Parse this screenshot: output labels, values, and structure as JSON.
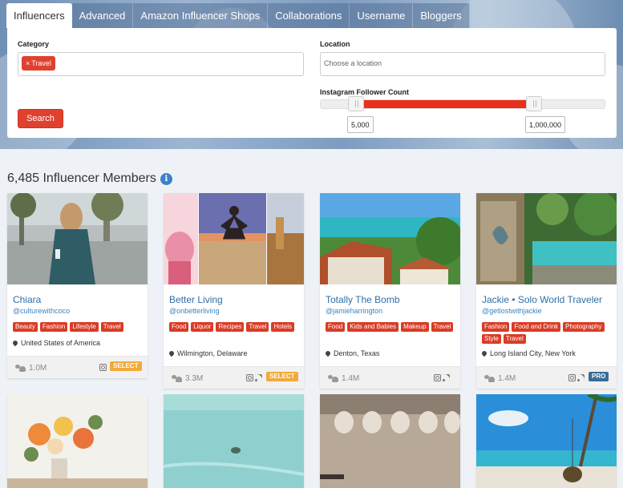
{
  "tabs": [
    "Influencers",
    "Advanced",
    "Amazon Influencer Shops",
    "Collaborations",
    "Username",
    "Bloggers"
  ],
  "filters": {
    "category_label": "Category",
    "category_chip": "Travel",
    "location_label": "Location",
    "location_placeholder": "Choose a location",
    "follower_label": "Instagram Follower Count",
    "follower_min": "5,000",
    "follower_max": "1,000,000",
    "search_label": "Search"
  },
  "members_count": "6,485 Influencer Members",
  "cards": [
    {
      "name": "Chiara",
      "handle": "@culturewithcoco",
      "tags": [
        "Beauty",
        "Fashion",
        "Lifestyle",
        "Travel"
      ],
      "location": "United States of America",
      "followers": "1.0M",
      "badge": "SELECT"
    },
    {
      "name": "Better Living",
      "handle": "@onbetterliving",
      "tags": [
        "Food",
        "Liquor",
        "Recipes",
        "Travel",
        "Hotels"
      ],
      "location": "Wilmington, Delaware",
      "followers": "3.3M",
      "badge": "SELECT"
    },
    {
      "name": "Totally The Bomb",
      "handle": "@jamieharrington",
      "tags": [
        "Food",
        "Kids and Babies",
        "Makeup",
        "Travel"
      ],
      "location": "Denton, Texas",
      "followers": "1.4M",
      "badge": ""
    },
    {
      "name": "Jackie • Solo World Traveler",
      "handle": "@getlostwithjackie",
      "tags": [
        "Fashion",
        "Food and Drink",
        "Photography",
        "Style",
        "Travel"
      ],
      "location": "Long Island City, New York",
      "followers": "1.4M",
      "badge": "PRO"
    }
  ],
  "colors": {
    "accent": "#e0412f",
    "link": "#2e6ea6",
    "select_badge": "#f2a93b",
    "pro_badge": "#3a6d95"
  }
}
